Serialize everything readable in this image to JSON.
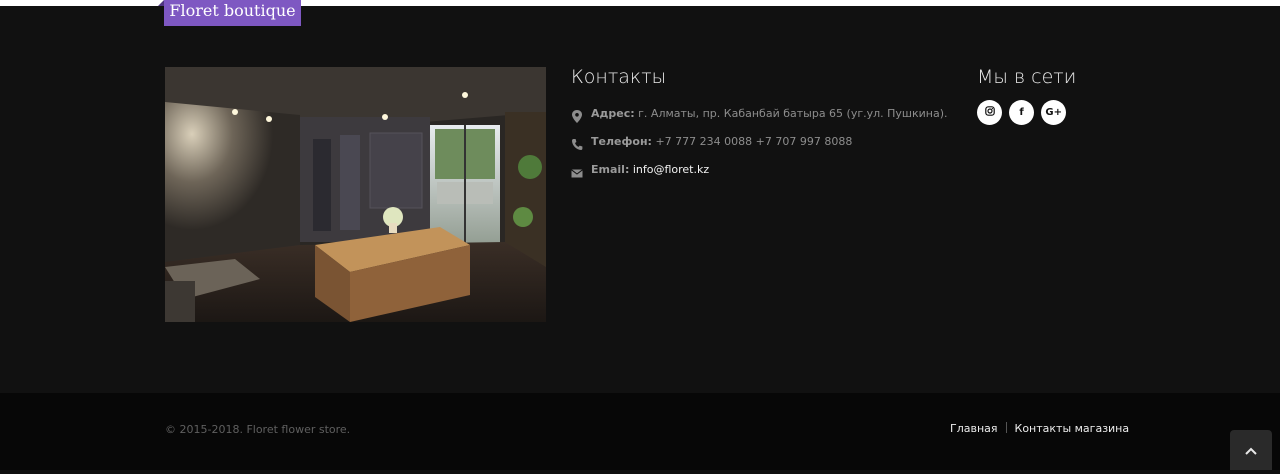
{
  "brand": {
    "name": "Floret boutique"
  },
  "contacts": {
    "title": "Контакты",
    "address_label": "Адрес:",
    "address_value": "г. Алматы, пр. Кабанбай батыра 65 (уг.ул. Пушкина).",
    "phone_label": "Телефон:",
    "phone_value": "+7 777 234 0088 +7 707 997 8088",
    "email_label": "Email:",
    "email_value": "info@floret.kz"
  },
  "social": {
    "title": "Мы в сети",
    "icons": [
      "instagram-icon",
      "facebook-icon",
      "google-plus-icon"
    ],
    "facebook_glyph": "f",
    "google_glyph": "G+"
  },
  "footer": {
    "copyright": "© 2015-2018. Floret flower store.",
    "nav": [
      "Главная",
      "Контакты магазина"
    ]
  },
  "colors": {
    "brand_tab": "#7e58c2",
    "page_bg": "#111111",
    "footer_bg": "#070707",
    "link": "#f2f2f2",
    "muted_text": "#8d8d8d"
  }
}
